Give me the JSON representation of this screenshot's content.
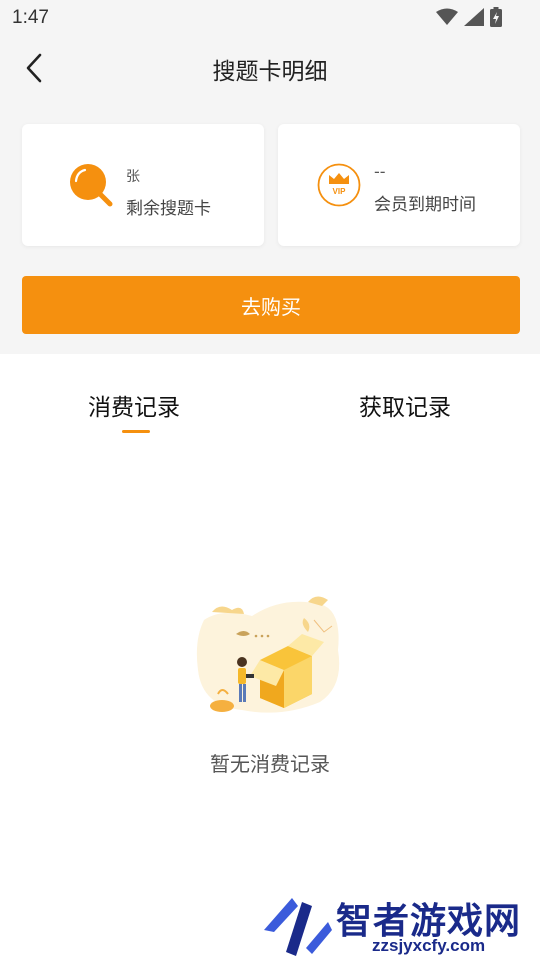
{
  "status_bar": {
    "time": "1:47"
  },
  "header": {
    "back_icon": "chevron-left-icon",
    "title": "搜题卡明细"
  },
  "cards": {
    "remaining": {
      "icon": "search-icon",
      "value": "张",
      "label": "剩余搜题卡"
    },
    "membership": {
      "icon": "vip-crown-icon",
      "value": "--",
      "label": "会员到期时间"
    }
  },
  "buy_button": {
    "label": "去购买"
  },
  "tabs": [
    {
      "label": "消费记录",
      "active": true
    },
    {
      "label": "获取记录",
      "active": false
    }
  ],
  "empty_state": {
    "message": "暂无消费记录"
  },
  "watermark": {
    "title": "智者游戏网",
    "url": "zzsjyxcfy.com"
  },
  "colors": {
    "accent": "#f5900f",
    "background": "#f5f5f5",
    "watermark": "#1a2a8a"
  }
}
